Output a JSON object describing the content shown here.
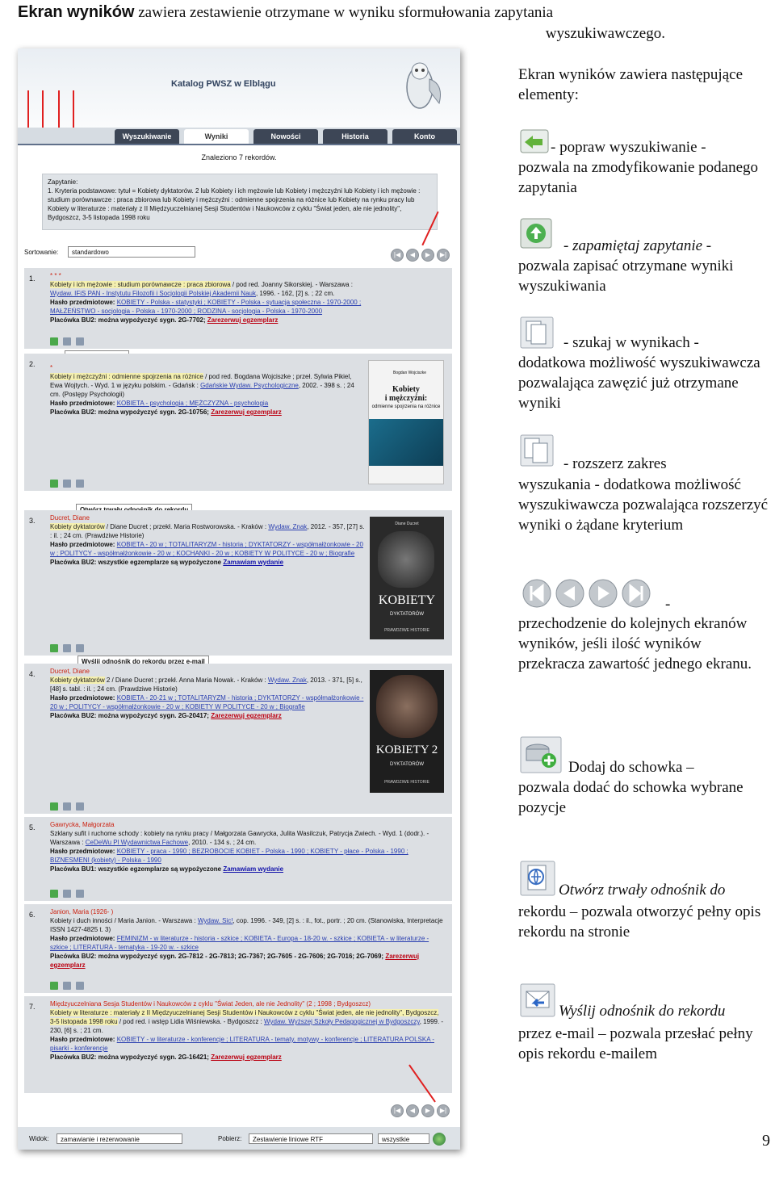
{
  "heading": {
    "bold": "Ekran wyników",
    "line1": " zawiera zestawienie otrzymane w wyniku sformułowania zapytania",
    "line2": "wyszukiwawczego."
  },
  "screenshot": {
    "title": "Katalog PWSZ w Elblągu",
    "tabs": [
      "Wyszukiwanie",
      "Wyniki",
      "Nowości",
      "Historia",
      "Konto"
    ],
    "found": "Znaleziono 7 rekordów.",
    "query_label": "Zapytanie:",
    "query_text": "1. Kryteria podstawowe: tytuł = Kobiety dyktatorów. 2 lub Kobiety i ich mężowie lub Kobiety i mężczyźni lub Kobiety i ich mężowie : studium porównawcze : praca zbiorowa lub Kobiety i mężczyźni : odmienne spojrzenia na różnice lub Kobiety na rynku pracy lub Kobiety w literaturze : materiały z II Międzyuczelnianej Sesji Studentów i Naukowców z cyklu \"Świat jeden, ale nie jednolity\", Bydgoszcz, 3-5 listopada 1998 roku",
    "sort_label": "Sortowanie:",
    "sort_value": "standardowo",
    "tooltips": {
      "schowek": "Dodaj do schowka",
      "odnosnik": "Otwórz trwały odnośnik do rekordu",
      "email": "Wyślij odnośnik do rekordu przez e-mail"
    },
    "records": [
      {
        "num": "1.",
        "author": "* * *",
        "title": "Kobiety i ich mężowie : studium porównawcze : praca zbiorowa",
        "rest": " / pod red. Joanny Sikorskiej. - Warszawa :",
        "publisher": "Wydaw. IFiS PAN - Instytutu Filozofii i Socjologii Polskiej Akademii Nauk",
        "pub_rest": ", 1996. - 162, [2] s. ; 22 cm.",
        "subjects": "KOBIETY - Polska - statystyki ; KOBIETY - Polska - sytuacja społeczna - 1970-2000 ; MAŁŻEŃSTWO - socjologia - Polska - 1970-2000 ; RODZINA - socjologia - Polska - 1970-2000",
        "placowka": "Placówka BU2: można wypożyczyć sygn. 2G-7702;",
        "action": "Zarezerwuj egzemplarz"
      },
      {
        "num": "2.",
        "author": "*",
        "title": "Kobiety i mężczyźni : odmienne spojrzenia na różnice",
        "rest": " / pod red. Bogdana Wojciszke ; przeł. Sylwia Pikiel, Ewa Wojtych. - Wyd. 1 w języku polskim. - Gdańsk :",
        "publisher": "Gdańskie Wydaw. Psychologiczne",
        "pub_rest": ", 2002. - 398 s. ; 24 cm. (Postępy Psychologii)",
        "subjects": "KOBIETA - psychologia ; MĘŻCZYZNA - psychologia",
        "placowka": "Placówka BU2: można wypożyczyć sygn. 2G-10756;",
        "action": "Zarezerwuj egzemplarz"
      },
      {
        "num": "3.",
        "author": "Ducret, Diane",
        "title": "Kobiety dyktatorów",
        "rest": " / Diane Ducret ; przekł. Maria Rostworowska. - Kraków :",
        "publisher": "Wydaw. Znak",
        "pub_rest": ", 2012. - 357, [27] s. : il. ; 24 cm. (Prawdziwe Historie)",
        "subjects": "KOBIETA - 20 w ; TOTALITARYZM - historia ; DYKTATORZY - współmałżonkowie - 20 w ; POLITYCY - współmałżonkowie - 20 w ; KOCHANKI - 20 w ; KOBIETY W POLITYCE - 20 w ; Biografie",
        "placowka": "Placówka BU2: wszystkie egzemplarze są wypożyczone",
        "action": "Zamawiam wydanie"
      },
      {
        "num": "4.",
        "author": "Ducret, Diane",
        "title": "Kobiety dyktatorów",
        "rest": " 2 / Diane Ducret ; przekł. Anna Maria Nowak. - Kraków :",
        "publisher": "Wydaw. Znak",
        "pub_rest": ", 2013. - 371, [5] s., [48] s. tabl. : il. ; 24 cm. (Prawdziwe Historie)",
        "subjects": "KOBIETA - 20-21 w ; TOTALITARYZM - historia ; DYKTATORZY - współmałżonkowie - 20 w ; POLITYCY - współmałżonkowie - 20 w ; KOBIETY W POLITYCE - 20 w ; Biografie",
        "placowka": "Placówka BU2: można wypożyczyć sygn. 2G-20417;",
        "action": "Zarezerwuj egzemplarz"
      },
      {
        "num": "5.",
        "author": "Gawrycka, Małgorzata",
        "title": "Szklany sufit i ruchome schody : kobiety na rynku pracy",
        "rest": " / Małgorzata Gawrycka, Julita Wasilczuk, Patrycja Zwiech. - Wyd. 1 (dodr.). - Warszawa :",
        "publisher": "CeDeWu Pl Wydawnictwa Fachowe",
        "pub_rest": ", 2010. - 134 s. ; 24 cm.",
        "subjects": "KOBIETY - praca - 1990 ; BEZROBOCIE KOBIET - Polska - 1990 ; KOBIETY - płace - Polska - 1990 ; BIZNESMENI (kobiety) - Polska - 1990",
        "placowka": "Placówka BU1: wszystkie egzemplarze są wypożyczone",
        "action": "Zamawiam wydanie"
      },
      {
        "num": "6.",
        "author": "Janion, Maria (1926- )",
        "title": "Kobiety i duch inności",
        "rest": " / Maria Janion. - Warszawa :",
        "publisher": "Wydaw. Sic!",
        "pub_rest": ", cop. 1996. - 349, [2] s. : il., fot., portr. ; 20 cm. (Stanowiska, Interpretacje ISSN 1427-4825 t. 3)",
        "subjects": "FEMINIZM - w literaturze - historia - szkice ; KOBIETA - Europa - 18-20 w. - szkice ; KOBIETA - w literaturze - szkice ; LITERATURA - tematyka - 19-20 w. - szkice",
        "placowka": "Placówka BU2: można wypożyczyć sygn. 2G-7812 - 2G-7813; 2G-7367; 2G-7605 - 2G-7606; 2G-7016; 2G-7069;",
        "action": "Zarezerwuj egzemplarz"
      },
      {
        "num": "7.",
        "author": "Międzyuczelniana Sesja Studentów i Naukowców z cyklu \"Świat Jeden, ale nie Jednolity\" (2 ; 1998 ; Bydgoszcz)",
        "title": "Kobiety w literaturze : materiały z II Międzyuczelnianej Sesji Studentów i Naukowców z cyklu \"Świat jeden, ale nie jednolity\", Bydgoszcz, 3-5 listopada 1998 roku",
        "rest": " / pod red. i wstęp Lidia Wiśniewska. - Bydgoszcz :",
        "publisher": "Wydaw. Wyższej Szkoły Pedagogicznej w Bydgoszczy",
        "pub_rest": ", 1999. - 230, [6] s. ; 21 cm.",
        "subjects": "KOBIETY - w literaturze - konferencje ; LITERATURA - tematy, motywy - konferencje ; LITERATURA POLSKA - pisarki - konferencje",
        "placowka": "Placówka BU2: można wypożyczyć sygn. 2G-16421;",
        "action": "Zarezerwuj egzemplarz"
      }
    ],
    "labels": {
      "haslo": "Hasło przedmiotowe:"
    },
    "covers": [
      {
        "line1": "Kobiety",
        "line2": "i mężczyźni:",
        "line3": "odmienne spojrzenia na różnice",
        "author": "Bogdan Wojciszke"
      },
      {
        "author": "Diane Ducret",
        "title": "KOBIETY",
        "sub": "DYKTATORÓW",
        "foot": "PRAWDZIWE HISTORIE"
      },
      {
        "title": "KOBIETY",
        "sub": "DYKTATORÓW",
        "num": "2",
        "foot": "PRAWDZIWE HISTORIE"
      }
    ],
    "bottom": {
      "widok_label": "Widok:",
      "widok_value": "zamawianie i rezerwowanie",
      "pobierz_label": "Pobierz:",
      "pobierz_value": "Zestawienie liniowe RTF",
      "scope_value": "wszystkie"
    }
  },
  "explanations": {
    "intro": "Ekran wyników zawiera następujące elementy:",
    "popraw": {
      "label": "- popraw wyszukiwanie -",
      "desc": "pozwala na zmodyfikowanie podanego zapytania"
    },
    "zapamietaj": {
      "label": "- zapamiętaj zapytanie -",
      "desc": "pozwala zapisać otrzymane wyniki wyszukiwania"
    },
    "szukaj": {
      "label": "- szukaj w wynikach -",
      "desc": "dodatkowa możliwość wyszukiwawcza pozwalająca zawęzić już otrzymane wyniki"
    },
    "rozszerz": {
      "label": "- rozszerz zakres",
      "desc": "wyszukania - dodatkowa możliwość wyszukiwawcza pozwalająca rozszerzyć wyniki o żądane kryterium"
    },
    "nawigacja": {
      "dash": "-",
      "desc": "przechodzenie do kolejnych ekranów wyników, jeśli ilość wyników przekracza zawartość jednego ekranu."
    },
    "schowek": {
      "label": "Dodaj do schowka –",
      "desc": "pozwala dodać do schowka wybrane pozycje"
    },
    "odnosnik": {
      "label": "Otwórz trwały odnośnik do",
      "label2": "rekordu",
      "desc": " – pozwala otworzyć pełny opis rekordu na stronie"
    },
    "email": {
      "label": "Wyślij odnośnik do rekordu",
      "label2": "przez e-mail",
      "desc": " – pozwala przesłać pełny opis rekordu e-mailem"
    }
  },
  "page_number": "9"
}
